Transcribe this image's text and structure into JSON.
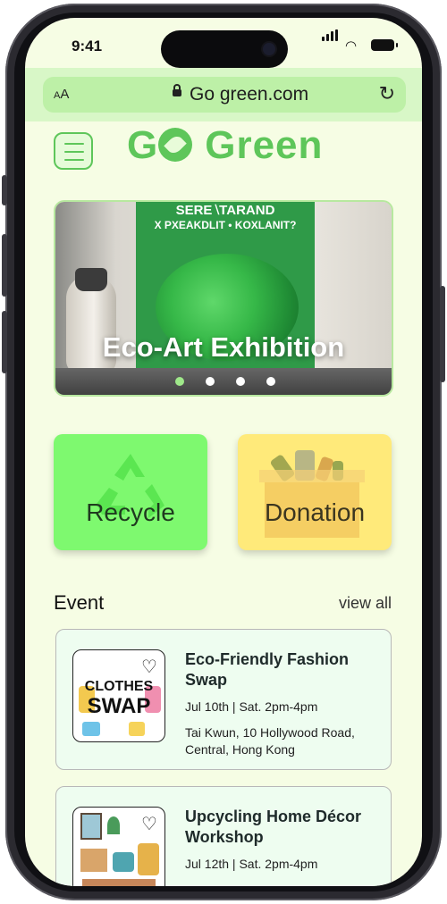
{
  "status_bar": {
    "time": "9:41"
  },
  "browser": {
    "text_size_label": "AA",
    "url": "Go green.com",
    "reload_icon": "reload-icon"
  },
  "header": {
    "logo_go": "GO",
    "logo_green": "Green",
    "menu_icon": "hamburger-menu-icon"
  },
  "banner": {
    "title": "Eco-Art Exhibition",
    "poster_text": "SERE )TARAND\nX PXEAKDLIT • KOXLANIT?",
    "slides": 4,
    "active_slide": 1
  },
  "categories": [
    {
      "label": "Recycle",
      "color": "#7ef96f"
    },
    {
      "label": "Donation",
      "color": "#ffea7a"
    }
  ],
  "events_section": {
    "title": "Event",
    "view_all": "view all",
    "items": [
      {
        "title": "Eco-Friendly Fashion Swap",
        "date": "Jul 10th |  Sat. 2pm-4pm",
        "location": "Tai Kwun, 10 Hollywood Road, Central, Hong Kong",
        "thumb_line1": "CLOTHES",
        "thumb_line2": "SWAP"
      },
      {
        "title": "Upcycling Home Décor Workshop",
        "date": "Jul 12th |  Sat. 2pm-4pm",
        "location": ""
      }
    ]
  },
  "colors": {
    "brand_green": "#5ec65a",
    "screen_bg": "#f6fde4",
    "urlbar": "#bdf0a7"
  }
}
